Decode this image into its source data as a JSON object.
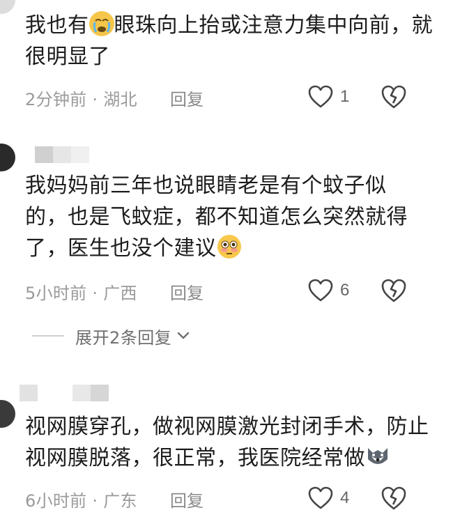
{
  "comments": [
    {
      "text_before": "我也有",
      "text_after": "眼珠向上抬或注意力集中向前，就很明显了",
      "emoji": "crying-face-icon",
      "time": "2分钟前 · 湖北",
      "reply_label": "回复",
      "likes": "1"
    },
    {
      "text_before": "我妈妈前三年也说眼睛老是有个蚊子似的，也是飞蚊症，都不知道怎么突然就得了，医生也没个建议",
      "text_after": "",
      "emoji": "flushed-face-icon",
      "time": "5小时前 · 广西",
      "reply_label": "回复",
      "likes": "6"
    },
    {
      "text_before": "视网膜穿孔，做视网膜激光封闭手术，防止视网膜脱落，很正常，我医院经常做",
      "text_after": "",
      "emoji": "husky-dog-icon",
      "time": "6小时前 · 广东",
      "reply_label": "回复",
      "likes": "4"
    }
  ],
  "expand_replies": {
    "label": "展开2条回复"
  },
  "colors": {
    "text": "#1c1c1c",
    "meta": "#9a9a9a",
    "icon": "#333333"
  }
}
